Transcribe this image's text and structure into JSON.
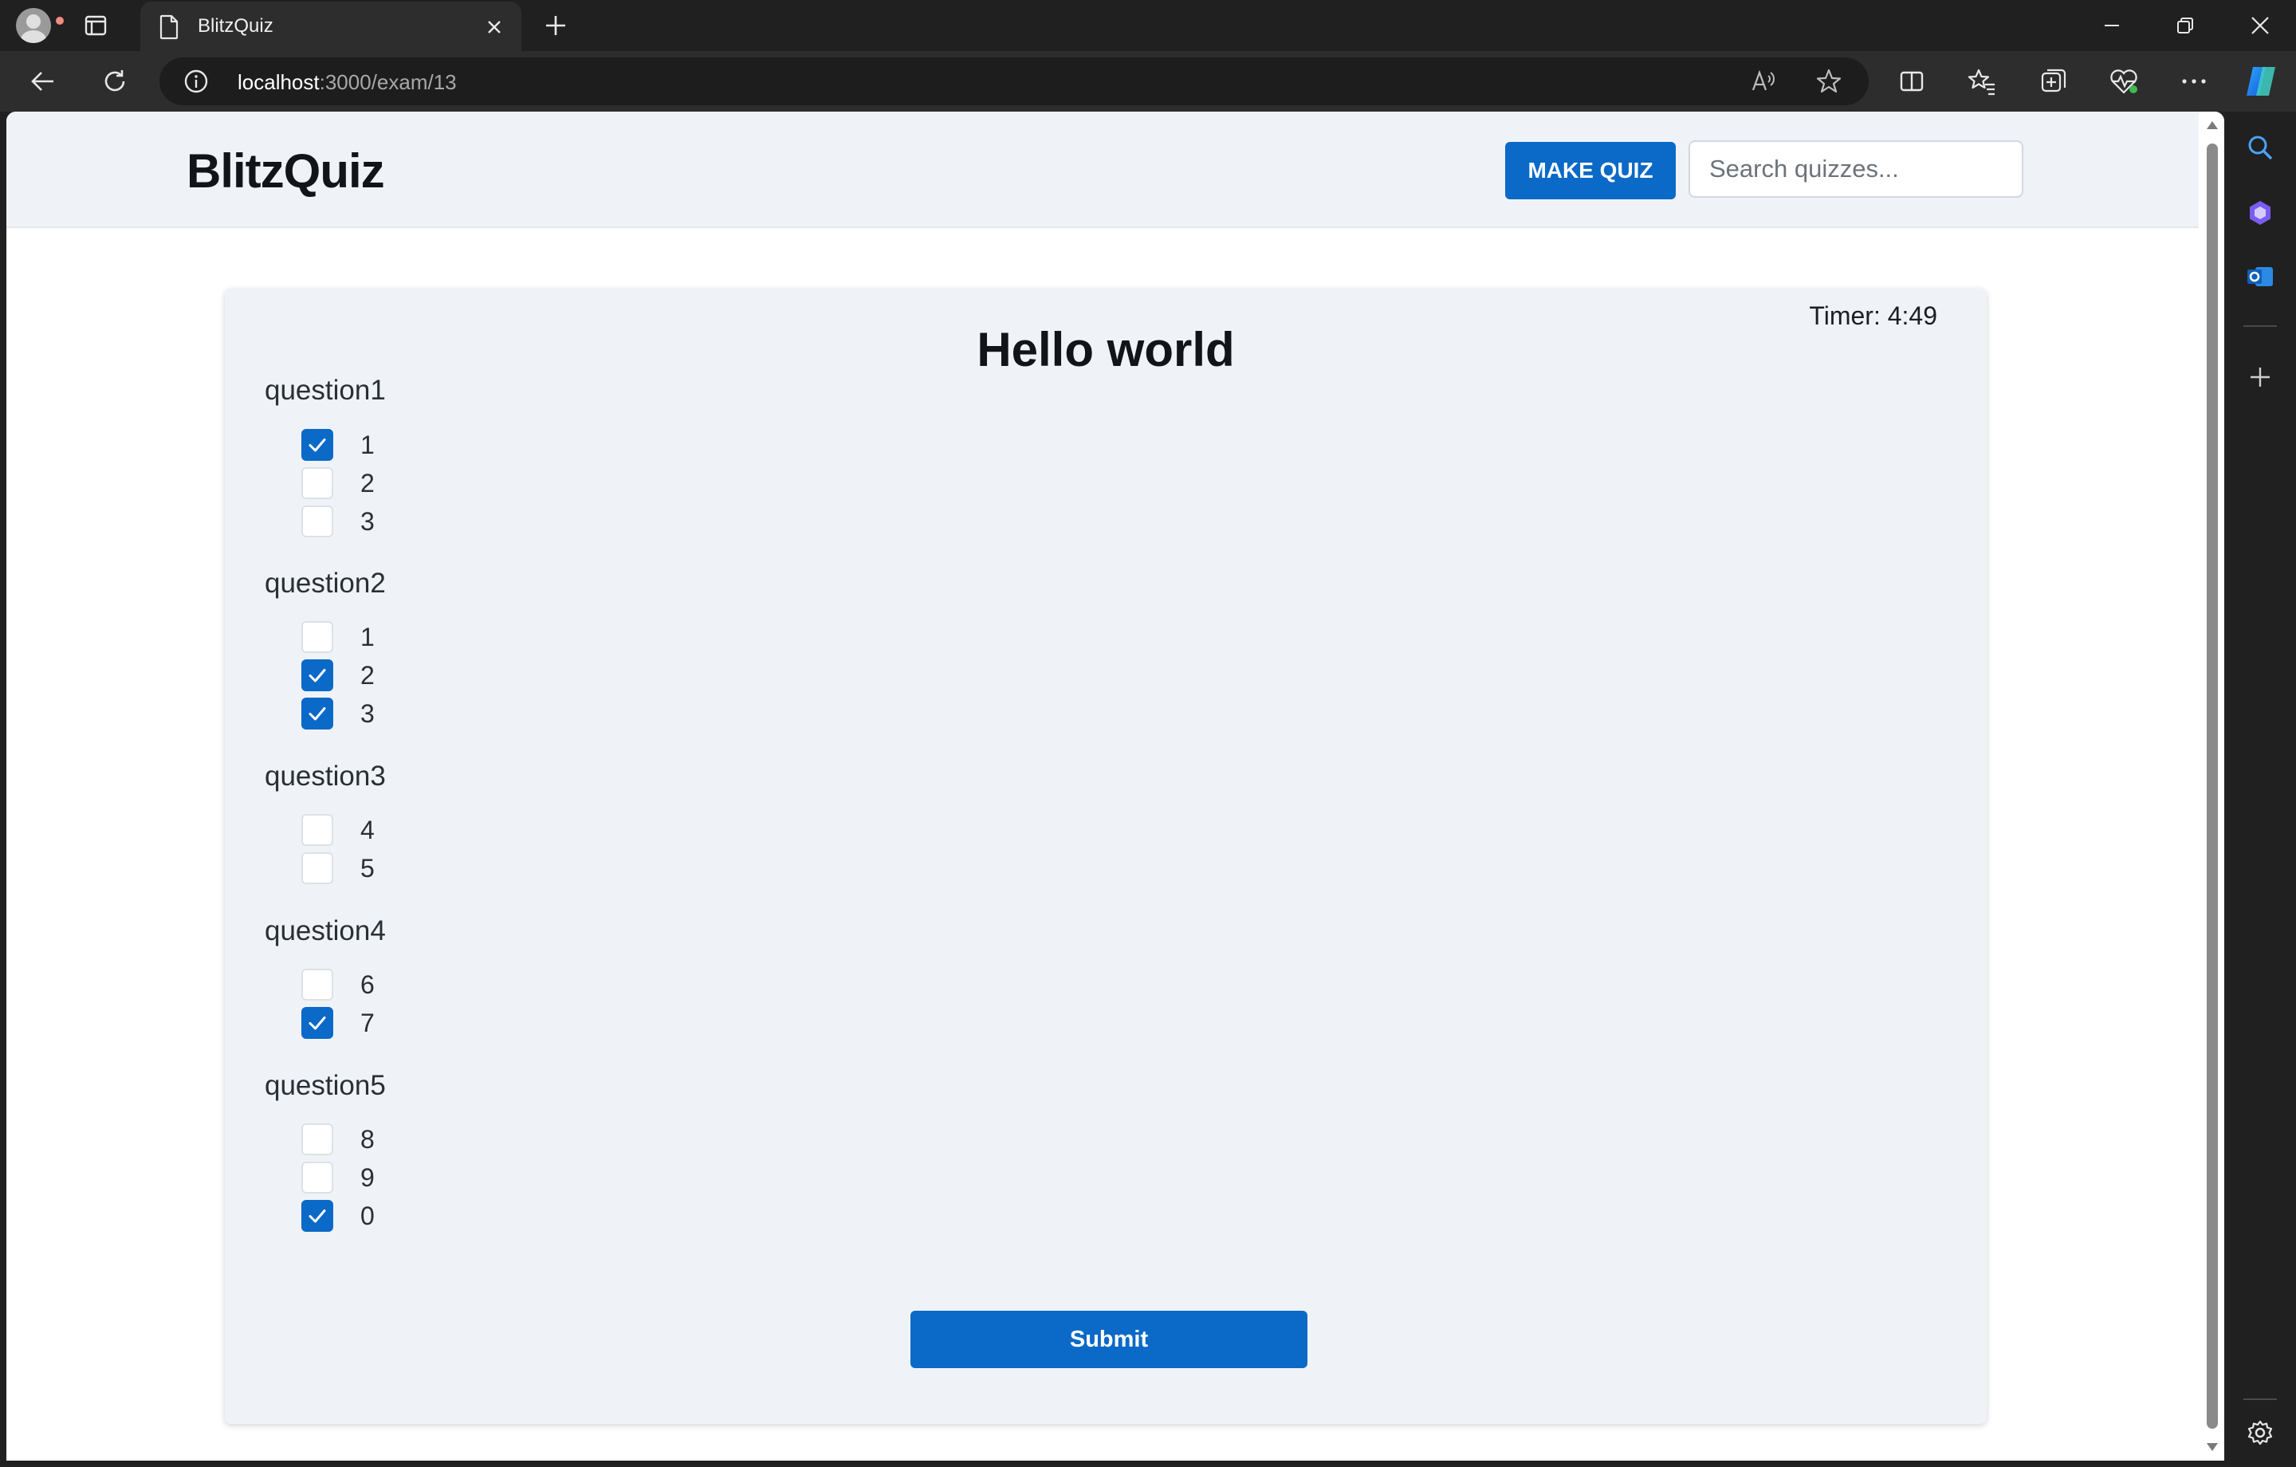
{
  "browser": {
    "tab_title": "BlitzQuiz",
    "url_host": "localhost",
    "url_path": ":3000/exam/13"
  },
  "nav": {
    "brand": "BlitzQuiz",
    "make_quiz_label": "MAKE QUIZ",
    "search_placeholder": "Search quizzes...",
    "search_value": ""
  },
  "exam": {
    "timer": "Timer: 4:49",
    "title": "Hello world",
    "questions": [
      {
        "title": "question1",
        "options": [
          {
            "label": "1",
            "checked": true
          },
          {
            "label": "2",
            "checked": false
          },
          {
            "label": "3",
            "checked": false
          }
        ]
      },
      {
        "title": "question2",
        "options": [
          {
            "label": "1",
            "checked": false
          },
          {
            "label": "2",
            "checked": true
          },
          {
            "label": "3",
            "checked": true
          }
        ]
      },
      {
        "title": "question3",
        "options": [
          {
            "label": "4",
            "checked": false
          },
          {
            "label": "5",
            "checked": false
          }
        ]
      },
      {
        "title": "question4",
        "options": [
          {
            "label": "6",
            "checked": false
          },
          {
            "label": "7",
            "checked": true
          }
        ]
      },
      {
        "title": "question5",
        "options": [
          {
            "label": "8",
            "checked": false
          },
          {
            "label": "9",
            "checked": false
          },
          {
            "label": "0",
            "checked": true
          }
        ]
      }
    ],
    "submit_label": "Submit"
  },
  "colors": {
    "accent": "#0b69c7",
    "page_bg": "#eff3f8",
    "chrome_bg": "#202020"
  },
  "icons": {
    "tab_page": "page-icon",
    "checkbox_checked": "check-icon"
  }
}
